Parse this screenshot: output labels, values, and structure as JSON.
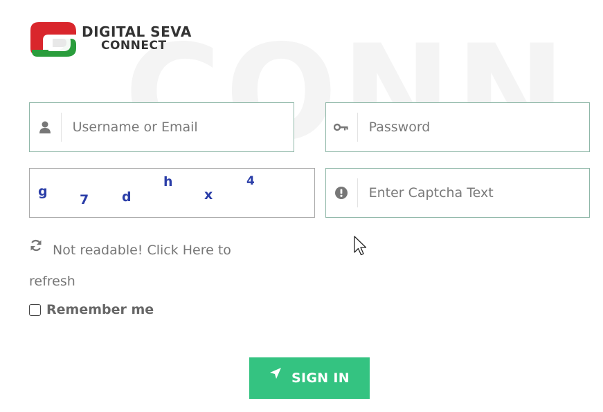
{
  "brand": {
    "line1": "DIGITAL SEVA",
    "line2": "CONNECT",
    "watermark": "CONN",
    "colors": {
      "red": "#d9262c",
      "green": "#2a9d3c",
      "accent": "#34c381"
    }
  },
  "form": {
    "username": {
      "placeholder": "Username or Email",
      "value": "",
      "icon": "user-icon"
    },
    "password": {
      "placeholder": "Password",
      "value": "",
      "icon": "key-icon"
    },
    "captcha": {
      "chars": [
        "g",
        "7",
        "d",
        "h",
        "x",
        "4"
      ],
      "input_placeholder": "Enter Captcha Text",
      "input_value": "",
      "icon": "exclamation-circle-icon"
    },
    "refresh_text": "Not readable! Click Here to refresh",
    "remember_label": "Remember me",
    "remember_checked": false,
    "signin_label": "SIGN IN"
  }
}
